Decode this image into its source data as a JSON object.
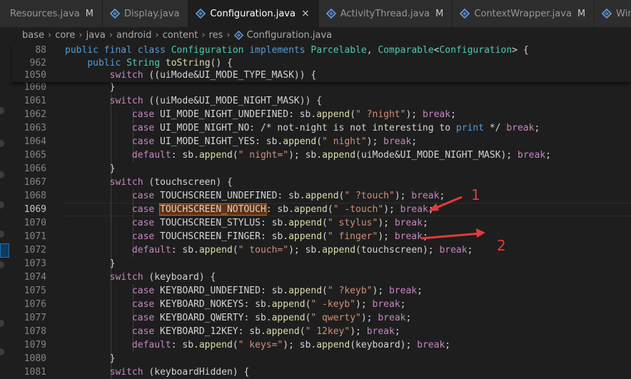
{
  "tabs": [
    {
      "label": "Resources.java",
      "modified": "M",
      "active": false
    },
    {
      "label": "Display.java",
      "modified": "",
      "active": false
    },
    {
      "label": "Configuration.java",
      "modified": "",
      "active": true,
      "close": "×"
    },
    {
      "label": "ActivityThread.java",
      "modified": "M",
      "active": false
    },
    {
      "label": "ContextWrapper.java",
      "modified": "M",
      "active": false
    },
    {
      "label": "Windo",
      "modified": "",
      "active": false
    }
  ],
  "breadcrumb": [
    "base",
    "core",
    "java",
    "android",
    "content",
    "res",
    "Configuration.java"
  ],
  "sticky": [
    {
      "num": "88",
      "html": "<span class='kwb'>public</span> <span class='kwb'>final</span> <span class='kwb'>class</span> <span class='ty'>Configuration</span> <span class='kwb'>implements</span> <span class='ty'>Parcelable</span>, <span class='ty'>Comparable</span>&lt;<span class='ty'>Configuration</span>&gt; {"
    },
    {
      "num": "962",
      "html": "    <span class='kwb'>public</span> <span class='ty'>String</span> <span class='fn'>toString</span>() {"
    },
    {
      "num": "1050",
      "html": "        <span class='kw'>switch</span> ((uiMode&amp;UI_MODE_TYPE_MASK)) {"
    }
  ],
  "lines": [
    {
      "num": "1060",
      "html": "        }"
    },
    {
      "num": "1061",
      "html": "        <span class='kw'>switch</span> ((uiMode&amp;UI_MODE_NIGHT_MASK)) {"
    },
    {
      "num": "1062",
      "html": "            <span class='kw'>case</span> UI_MODE_NIGHT_UNDEFINED: sb.<span class='fn'>append</span>(<span class='str'>\" ?night\"</span>); <span class='kw'>break</span>;"
    },
    {
      "num": "1063",
      "html": "            <span class='kw'>case</span> UI_MODE_NIGHT_NO: /* not-night is not interesting to <span class='kwb'>print</span> */ <span class='kw'>break</span>;"
    },
    {
      "num": "1064",
      "html": "            <span class='kw'>case</span> UI_MODE_NIGHT_YES: sb.<span class='fn'>append</span>(<span class='str'>\" night\"</span>); <span class='kw'>break</span>;"
    },
    {
      "num": "1065",
      "html": "            <span class='kw'>default</span>: sb.<span class='fn'>append</span>(<span class='str'>\" night=\"</span>); sb.<span class='fn'>append</span>(uiMode&amp;UI_MODE_NIGHT_MASK); <span class='kw'>break</span>;"
    },
    {
      "num": "1066",
      "html": "        }"
    },
    {
      "num": "1067",
      "html": "        <span class='kw'>switch</span> (touchscreen) {"
    },
    {
      "num": "1068",
      "html": "            <span class='kw'>case</span> TOUCHSCREEN_UNDEFINED: sb.<span class='fn'>append</span>(<span class='str'>\" ?touch\"</span>); <span class='kw'>break</span>;"
    },
    {
      "num": "1069",
      "html": "            <span class='kw'>case</span> <span class='hl'>TOUCHSCREEN_NOTOUCH</span>: sb.<span class='fn'>append</span>(<span class='str'>\" -touch\"</span>); <span class='kw'>break</span>;",
      "current": true
    },
    {
      "num": "1070",
      "html": "            <span class='kw'>case</span> TOUCHSCREEN_STYLUS: sb.<span class='fn'>append</span>(<span class='str'>\" stylus\"</span>); <span class='kw'>break</span>;"
    },
    {
      "num": "1071",
      "html": "            <span class='kw'>case</span> TOUCHSCREEN_FINGER: sb.<span class='fn'>append</span>(<span class='str'>\" finger\"</span>); <span class='kw'>break</span>;"
    },
    {
      "num": "1072",
      "html": "            <span class='kw'>default</span>: sb.<span class='fn'>append</span>(<span class='str'>\" touch=\"</span>); sb.<span class='fn'>append</span>(touchscreen); <span class='kw'>break</span>;"
    },
    {
      "num": "1073",
      "html": "        }"
    },
    {
      "num": "1074",
      "html": "        <span class='kw'>switch</span> (keyboard) {"
    },
    {
      "num": "1075",
      "html": "            <span class='kw'>case</span> KEYBOARD_UNDEFINED: sb.<span class='fn'>append</span>(<span class='str'>\" ?keyb\"</span>); <span class='kw'>break</span>;"
    },
    {
      "num": "1076",
      "html": "            <span class='kw'>case</span> KEYBOARD_NOKEYS: sb.<span class='fn'>append</span>(<span class='str'>\" -keyb\"</span>); <span class='kw'>break</span>;"
    },
    {
      "num": "1077",
      "html": "            <span class='kw'>case</span> KEYBOARD_QWERTY: sb.<span class='fn'>append</span>(<span class='str'>\" qwerty\"</span>); <span class='kw'>break</span>;"
    },
    {
      "num": "1078",
      "html": "            <span class='kw'>case</span> KEYBOARD_12KEY: sb.<span class='fn'>append</span>(<span class='str'>\" 12key\"</span>); <span class='kw'>break</span>;"
    },
    {
      "num": "1079",
      "html": "            <span class='kw'>default</span>: sb.<span class='fn'>append</span>(<span class='str'>\" keys=\"</span>); sb.<span class='fn'>append</span>(keyboard); <span class='kw'>break</span>;"
    },
    {
      "num": "1080",
      "html": "        }"
    },
    {
      "num": "1081",
      "html": "        <span class='kw'>switch</span> (keyboardHidden) {"
    }
  ],
  "annotations": [
    {
      "label": "1",
      "color": "#e23b3b"
    },
    {
      "label": "2",
      "color": "#e23b3b"
    }
  ]
}
